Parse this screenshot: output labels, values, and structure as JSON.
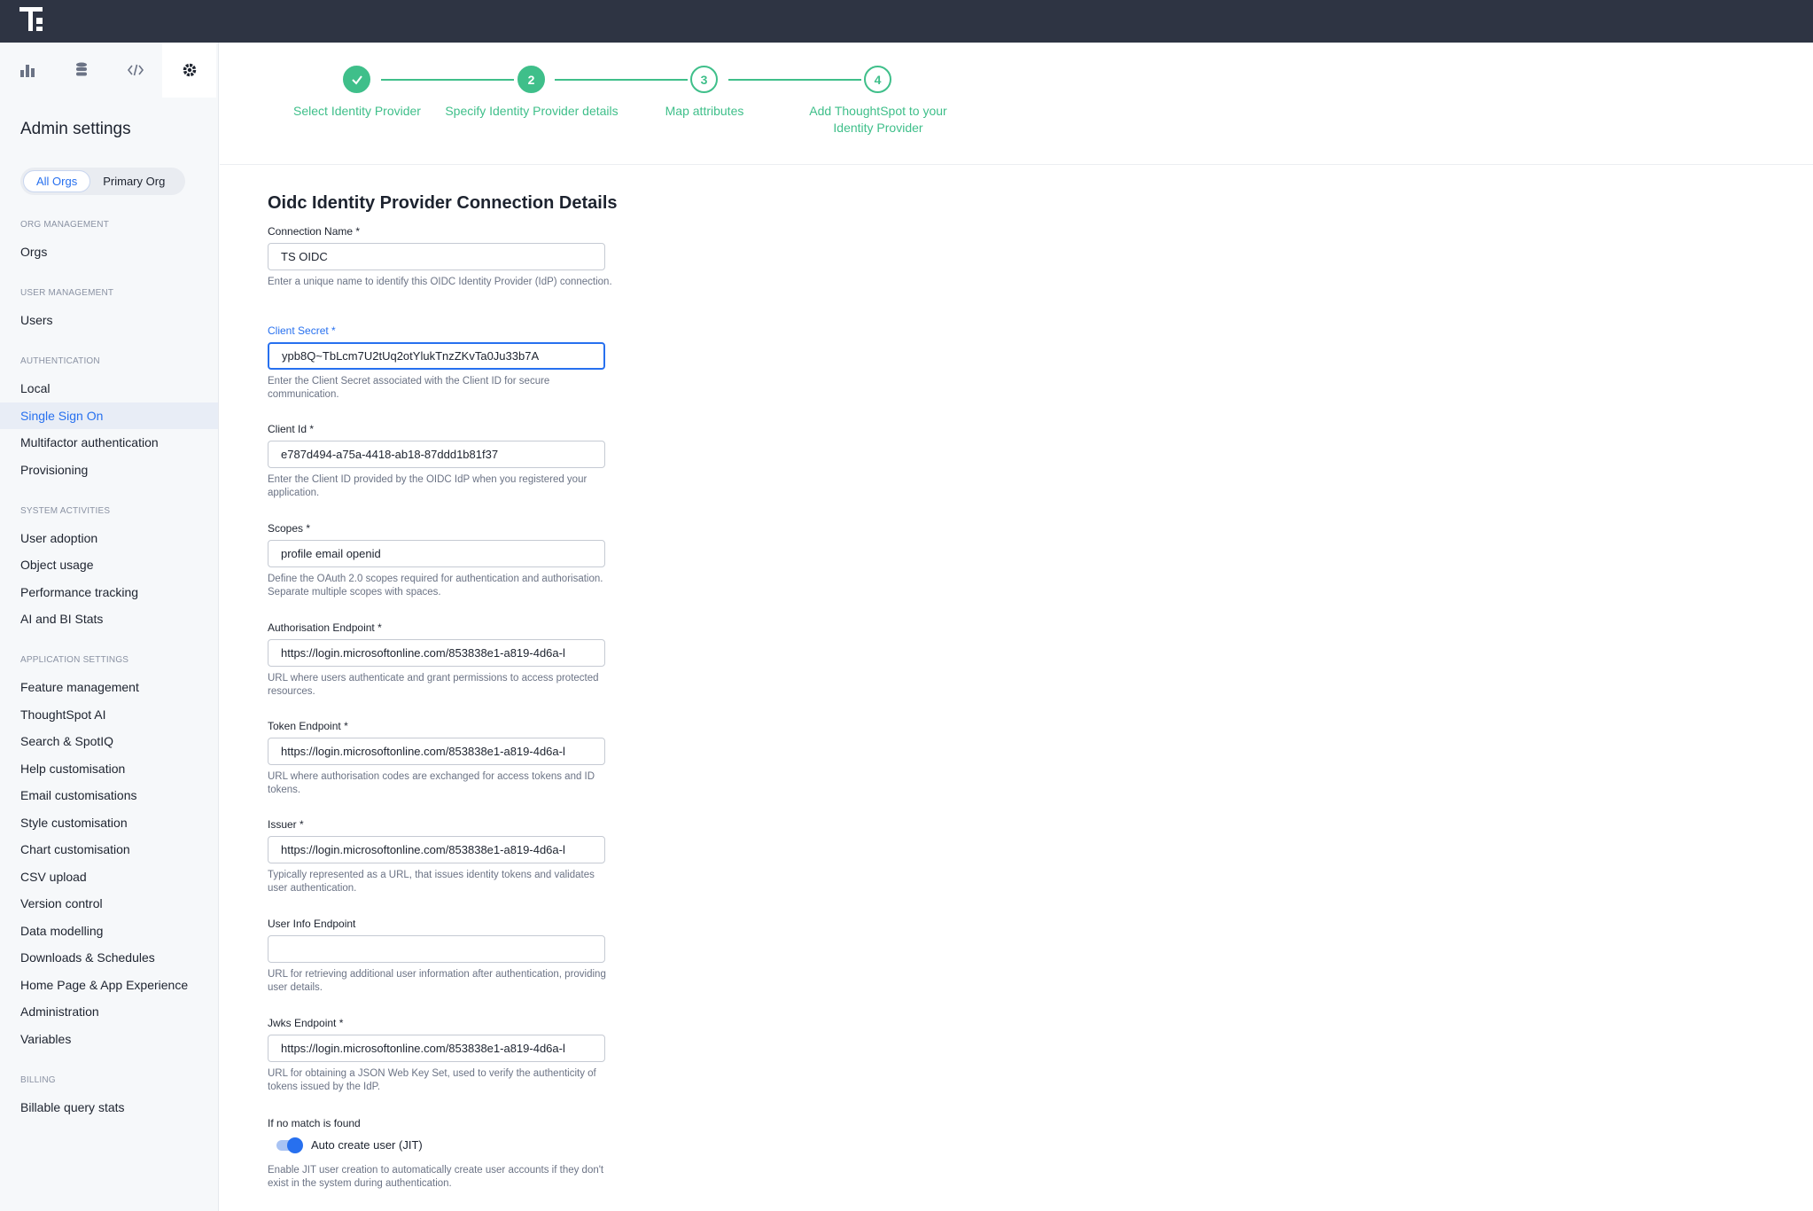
{
  "sidebar": {
    "icon_tabs": [
      {
        "icon": "bar-chart-icon"
      },
      {
        "icon": "database-icon"
      },
      {
        "icon": "code-icon"
      },
      {
        "icon": "gear-icon",
        "active": true
      }
    ],
    "title": "Admin settings",
    "org_switch": {
      "options": [
        "All Orgs",
        "Primary Org"
      ],
      "selected": "All Orgs"
    },
    "sections": {
      "org_management": "ORG MANAGEMENT",
      "user_management": "USER MANAGEMENT",
      "authentication": "AUTHENTICATION",
      "system_activities": "SYSTEM ACTIVITIES",
      "application_settings": "APPLICATION SETTINGS",
      "billing": "BILLING"
    },
    "items": {
      "orgs": "Orgs",
      "users": "Users",
      "local": "Local",
      "single_sign_on": "Single Sign On",
      "multifactor": "Multifactor authentication",
      "provisioning": "Provisioning",
      "user_adoption": "User adoption",
      "object_usage": "Object usage",
      "performance_tracking": "Performance tracking",
      "ai_bi_stats": "AI and BI Stats",
      "feature_management": "Feature management",
      "thoughtspot_ai": "ThoughtSpot AI",
      "search_spotiq": "Search & SpotIQ",
      "help_customisation": "Help customisation",
      "email_customisations": "Email customisations",
      "style_customisation": "Style customisation",
      "chart_customisation": "Chart customisation",
      "csv_upload": "CSV upload",
      "version_control": "Version control",
      "data_modelling": "Data modelling",
      "downloads_schedules": "Downloads & Schedules",
      "home_page": "Home Page & App Experience",
      "administration": "Administration",
      "variables": "Variables",
      "billable_query_stats": "Billable query stats"
    },
    "active_item": "Single Sign On"
  },
  "stepper": {
    "steps": [
      {
        "number": "1",
        "label": "Select Identity Provider",
        "state": "done"
      },
      {
        "number": "2",
        "label": "Specify Identity Provider details",
        "state": "current"
      },
      {
        "number": "3",
        "label": "Map attributes",
        "state": "pending"
      },
      {
        "number": "4",
        "label": "Add ThoughtSpot to your Identity Provider",
        "state": "pending"
      }
    ]
  },
  "form": {
    "title": "Oidc Identity Provider Connection Details",
    "connection_name": {
      "label": "Connection Name *",
      "value": "TS OIDC",
      "help": "Enter a unique name to identify this OIDC Identity Provider (IdP) connection."
    },
    "client_secret": {
      "label": "Client Secret *",
      "value": "ypb8Q~TbLcm7U2tUq2otYlukTnzZKvTa0Ju33b7A",
      "help": "Enter the Client Secret associated with the Client ID for secure communication."
    },
    "client_id": {
      "label": "Client Id *",
      "value": "e787d494-a75a-4418-ab18-87ddd1b81f37",
      "help": "Enter the Client ID provided by the OIDC IdP when you registered your application."
    },
    "scopes": {
      "label": "Scopes *",
      "value": "profile email openid",
      "help": "Define the OAuth 2.0 scopes required for authentication and authorisation. Separate multiple scopes with spaces."
    },
    "authorisation_endpoint": {
      "label": "Authorisation Endpoint *",
      "value": "https://login.microsoftonline.com/853838e1-a819-4d6a-l",
      "help": "URL where users authenticate and grant permissions to access protected resources."
    },
    "token_endpoint": {
      "label": "Token Endpoint *",
      "value": "https://login.microsoftonline.com/853838e1-a819-4d6a-l",
      "help": "URL where authorisation codes are exchanged for access tokens and ID tokens."
    },
    "issuer": {
      "label": "Issuer *",
      "value": "https://login.microsoftonline.com/853838e1-a819-4d6a-l",
      "help": "Typically represented as a URL, that issues identity tokens and validates user authentication."
    },
    "user_info_endpoint": {
      "label": "User Info Endpoint",
      "value": "",
      "help": "URL for retrieving additional user information after authentication, providing user details."
    },
    "jwks_endpoint": {
      "label": "Jwks Endpoint *",
      "value": "https://login.microsoftonline.com/853838e1-a819-4d6a-l",
      "help": "URL for obtaining a JSON Web Key Set, used to verify the authenticity of tokens issued by the IdP."
    },
    "no_match": {
      "label": "If no match is found",
      "toggle_label": "Auto create user (JIT)",
      "toggle_on": true,
      "help": "Enable JIT user creation to automatically create user accounts if they don't exist in the system during authentication."
    }
  },
  "colors": {
    "accent": "#2770ef",
    "success": "#3fbf8a",
    "topbar": "#2e3443"
  }
}
